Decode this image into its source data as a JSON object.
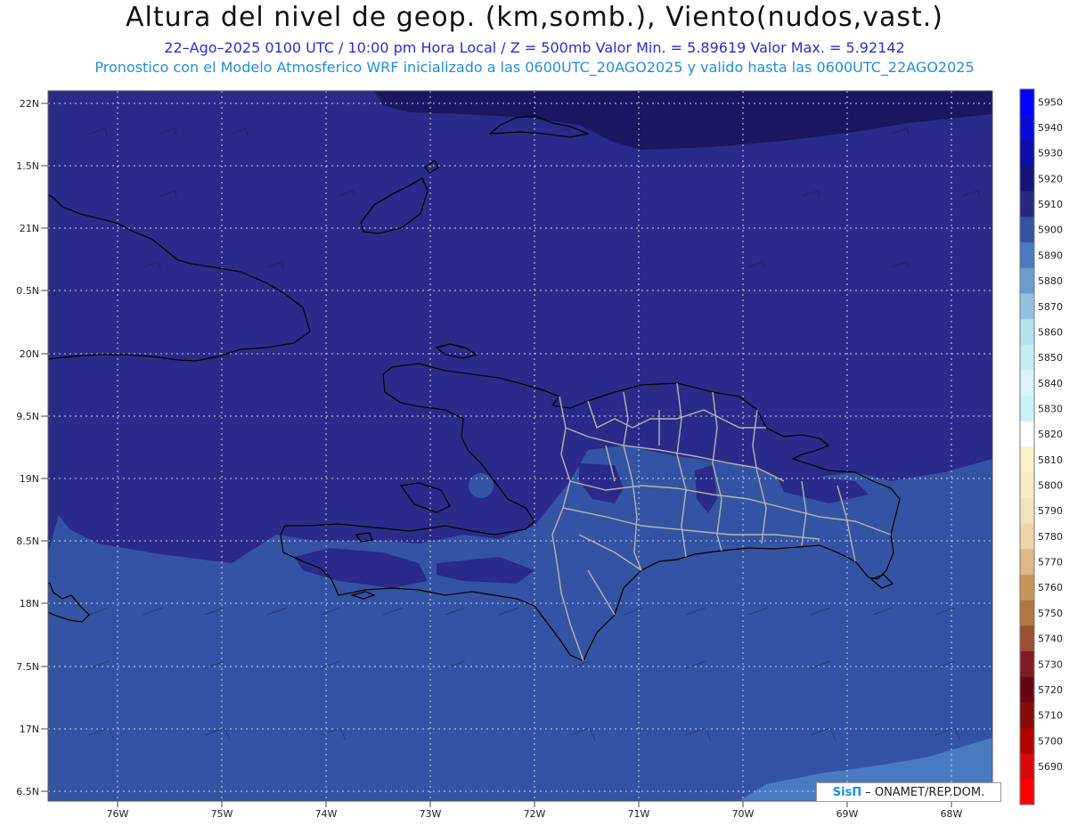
{
  "header": {
    "title": "Altura del nivel de geop. (km,somb.), Viento(nudos,vast.)",
    "subtitle": "22–Ago–2025  0100 UTC / 10:00 pm Hora Local / Z = 500mb     Valor Min. = 5.89619   Valor Max. = 5.92142",
    "model_info": "Pronostico con el Modelo Atmosferico WRF inicializado a las 0600UTC_20AGO2025 y valido hasta las  0600UTC_22AGO2025"
  },
  "map": {
    "lon_labels": [
      "76W",
      "75W",
      "74W",
      "73W",
      "72W",
      "71W",
      "70W",
      "69W",
      "68W"
    ],
    "lat_labels": [
      "22N",
      "1.5N",
      "21N",
      "0.5N",
      "20N",
      "9.5N",
      "19N",
      "8.5N",
      "18N",
      "7.5N",
      "17N",
      "6.5N"
    ],
    "colors": {
      "field_high": "#2a2a88",
      "field_mid": "#3553a3",
      "field_low": "#4a7ac0",
      "field_top": "#1a1660",
      "coast": "#000000",
      "borders": "#b4b4b4"
    }
  },
  "colorbar": {
    "labels": [
      "5950",
      "5940",
      "5930",
      "5920",
      "5910",
      "5900",
      "5890",
      "5880",
      "5870",
      "5860",
      "5850",
      "5840",
      "5830",
      "5820",
      "5810",
      "5800",
      "5790",
      "5780",
      "5770",
      "5760",
      "5750",
      "5740",
      "5730",
      "5720",
      "5710",
      "5700",
      "5690"
    ],
    "colors": [
      "#0000ff",
      "#0a0ad6",
      "#0c0ca8",
      "#13137a",
      "#28287f",
      "#3553a3",
      "#4a7ac0",
      "#6a9ccc",
      "#93c1e1",
      "#b6e1ef",
      "#c6ecf4",
      "#daf4f8",
      "#c9f3f7",
      "#ffffff",
      "#fbf1c8",
      "#f7ecc4",
      "#f2e3ba",
      "#eed6a8",
      "#deb886",
      "#c99659",
      "#b27640",
      "#9a5030",
      "#7e1c24",
      "#680714",
      "#860c0c",
      "#b30000",
      "#d90808",
      "#ff0000"
    ]
  },
  "credit": {
    "logo": "SisΠ",
    "text": "– ONAMET/REP.DOM."
  }
}
